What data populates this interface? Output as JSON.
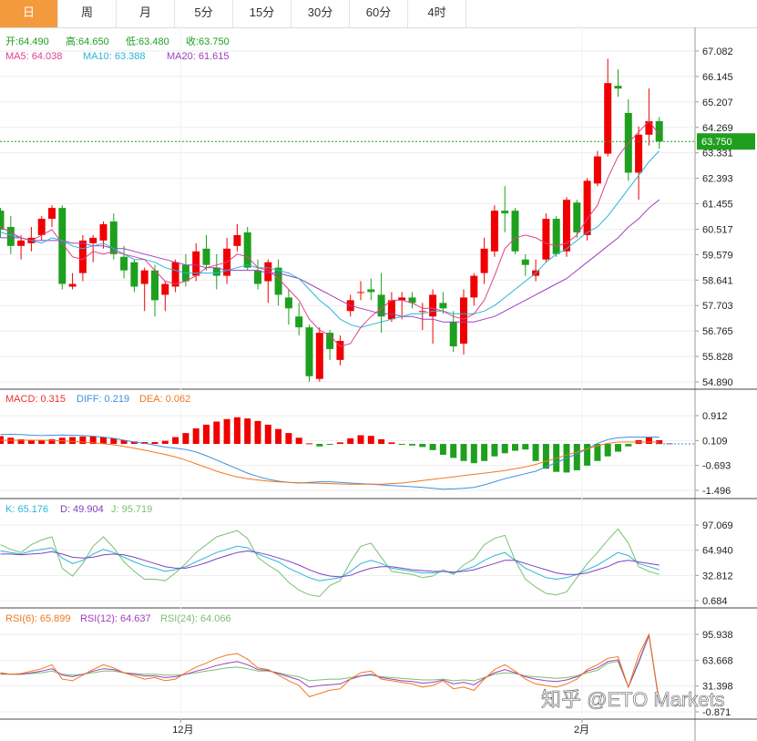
{
  "tabs": [
    "日",
    "周",
    "月",
    "5分",
    "15分",
    "30分",
    "60分",
    "4时"
  ],
  "active_tab": 0,
  "ohlc_labels": {
    "open": "开:64.490",
    "high": "高:64.650",
    "low": "低:63.480",
    "close": "收:63.750"
  },
  "ma_labels": {
    "ma5": "MA5: 64.038",
    "ma10": "MA10: 63.388",
    "ma20": "MA20: 61.615"
  },
  "macd_labels": {
    "macd": "MACD: 0.315",
    "diff": "DIFF: 0.219",
    "dea": "DEA: 0.062"
  },
  "kdj_labels": {
    "k": "K: 65.176",
    "d": "D: 49.904",
    "j": "J: 95.719"
  },
  "rsi_labels": {
    "rsi6": "RSI(6): 65.899",
    "rsi12": "RSI(12): 64.637",
    "rsi24": "RSI(24): 64.066"
  },
  "watermark": "知乎 @ETO Markets",
  "colors": {
    "up": "#f00000",
    "down": "#1ea01e",
    "ma5": "#e0408c",
    "ma10": "#29b6d8",
    "ma20": "#a040c0",
    "diff": "#3d8ee0",
    "dea": "#f07820",
    "k": "#29b6d8",
    "d": "#8040c0",
    "j": "#7ac070",
    "rsi6": "#f07820",
    "rsi12": "#a040c0",
    "rsi24": "#7ac070",
    "price_tag": "#1ea01e",
    "tab_active": "#f39a3c"
  },
  "chart_data": [
    {
      "type": "candlestick",
      "name_label": "",
      "yticks": [
        "67.082",
        "66.145",
        "65.207",
        "64.269",
        "63.331",
        "62.393",
        "61.455",
        "60.517",
        "59.579",
        "58.641",
        "57.703",
        "56.765",
        "55.828",
        "54.890"
      ],
      "ylim": [
        54.89,
        67.082
      ],
      "xticks": [
        {
          "label": "12月",
          "index": 17.5
        },
        {
          "label": "2月",
          "index": 56.5
        }
      ],
      "last_price": "63.750",
      "ohlc": [
        [
          61.2,
          61.3,
          60.2,
          60.5
        ],
        [
          60.6,
          61.0,
          59.6,
          59.9
        ],
        [
          59.9,
          60.3,
          59.4,
          60.1
        ],
        [
          60.0,
          60.6,
          59.7,
          60.2
        ],
        [
          60.3,
          61.0,
          60.1,
          60.9
        ],
        [
          60.9,
          61.4,
          60.6,
          61.3
        ],
        [
          61.3,
          61.4,
          58.3,
          58.5
        ],
        [
          58.4,
          58.9,
          58.3,
          58.5
        ],
        [
          58.9,
          60.3,
          58.6,
          60.1
        ],
        [
          60.0,
          60.3,
          59.3,
          60.2
        ],
        [
          60.1,
          60.8,
          59.8,
          60.7
        ],
        [
          60.8,
          61.1,
          59.4,
          59.6
        ],
        [
          59.5,
          59.9,
          58.7,
          59.0
        ],
        [
          59.3,
          59.4,
          58.2,
          58.4
        ],
        [
          58.5,
          59.1,
          57.5,
          59.0
        ],
        [
          59.0,
          59.2,
          57.3,
          57.9
        ],
        [
          58.1,
          58.6,
          57.5,
          58.5
        ],
        [
          58.4,
          59.4,
          58.2,
          59.3
        ],
        [
          59.2,
          59.6,
          58.4,
          58.6
        ],
        [
          58.8,
          60.0,
          58.6,
          59.7
        ],
        [
          59.8,
          60.3,
          59.0,
          59.2
        ],
        [
          59.1,
          59.6,
          58.3,
          58.8
        ],
        [
          58.8,
          60.2,
          58.5,
          59.8
        ],
        [
          59.9,
          60.7,
          59.7,
          60.3
        ],
        [
          60.4,
          60.6,
          59.0,
          59.1
        ],
        [
          59.0,
          59.4,
          58.3,
          58.5
        ],
        [
          58.6,
          59.4,
          57.8,
          59.3
        ],
        [
          59.1,
          59.4,
          57.7,
          58.1
        ],
        [
          58.0,
          58.3,
          57.0,
          57.6
        ],
        [
          57.3,
          57.8,
          56.6,
          56.9
        ],
        [
          56.9,
          57.0,
          54.9,
          55.1
        ],
        [
          55.0,
          56.9,
          54.9,
          56.7
        ],
        [
          56.7,
          56.8,
          55.7,
          56.1
        ],
        [
          55.7,
          56.6,
          55.5,
          56.4
        ],
        [
          57.5,
          58.1,
          57.3,
          57.9
        ],
        [
          58.2,
          58.6,
          57.9,
          58.2
        ],
        [
          58.3,
          58.7,
          57.9,
          58.2
        ],
        [
          58.1,
          58.9,
          56.7,
          57.3
        ],
        [
          57.2,
          58.2,
          57.1,
          57.9
        ],
        [
          57.9,
          58.2,
          57.2,
          58.0
        ],
        [
          58.0,
          58.2,
          57.6,
          57.8
        ],
        [
          57.5,
          57.8,
          56.8,
          57.5
        ],
        [
          57.3,
          58.3,
          56.3,
          58.1
        ],
        [
          57.8,
          58.2,
          57.4,
          57.6
        ],
        [
          57.1,
          57.5,
          56.0,
          56.2
        ],
        [
          56.3,
          58.3,
          55.9,
          58.0
        ],
        [
          58.0,
          58.9,
          57.7,
          58.8
        ],
        [
          58.9,
          60.2,
          58.5,
          59.8
        ],
        [
          59.7,
          61.4,
          59.5,
          61.2
        ],
        [
          61.2,
          62.1,
          60.4,
          61.1
        ],
        [
          61.2,
          61.3,
          59.6,
          59.7
        ],
        [
          59.4,
          59.6,
          58.8,
          59.2
        ],
        [
          58.8,
          59.4,
          58.6,
          59.0
        ],
        [
          59.4,
          61.1,
          59.3,
          60.9
        ],
        [
          60.9,
          61.0,
          59.5,
          59.6
        ],
        [
          59.7,
          61.7,
          59.5,
          61.6
        ],
        [
          61.5,
          61.6,
          60.2,
          60.4
        ],
        [
          60.3,
          62.4,
          60.1,
          62.3
        ],
        [
          62.2,
          63.4,
          62.1,
          63.2
        ],
        [
          63.3,
          66.8,
          63.2,
          65.9
        ],
        [
          65.8,
          66.4,
          65.4,
          65.7
        ],
        [
          64.8,
          65.3,
          62.3,
          62.6
        ],
        [
          62.6,
          64.3,
          61.6,
          64.0
        ],
        [
          64.0,
          65.7,
          63.6,
          64.5
        ],
        [
          64.5,
          64.65,
          63.48,
          63.75
        ]
      ],
      "ma5": [
        60.6,
        60.4,
        60.2,
        60.1,
        60.3,
        60.5,
        60.0,
        59.5,
        59.4,
        59.7,
        59.6,
        59.7,
        59.6,
        59.5,
        59.4,
        59.0,
        58.6,
        58.5,
        58.6,
        58.8,
        59.1,
        59.2,
        59.3,
        59.6,
        59.5,
        59.1,
        59.0,
        58.7,
        58.3,
        57.9,
        57.2,
        56.8,
        56.6,
        56.2,
        56.3,
        56.9,
        57.3,
        57.6,
        57.9,
        57.9,
        57.8,
        57.6,
        57.6,
        57.5,
        57.3,
        57.2,
        57.4,
        57.9,
        58.8,
        59.8,
        60.2,
        60.3,
        60.2,
        60.0,
        59.9,
        60.0,
        60.3,
        60.9,
        61.4,
        62.4,
        63.2,
        63.7,
        64.1,
        64.5,
        64.0
      ],
      "ma10": [
        60.4,
        60.3,
        60.2,
        60.1,
        60.0,
        60.2,
        60.1,
        59.9,
        59.8,
        59.9,
        60.0,
        59.8,
        59.6,
        59.4,
        59.4,
        59.3,
        59.1,
        59.0,
        58.9,
        58.9,
        58.9,
        58.9,
        59.0,
        59.1,
        59.2,
        59.1,
        59.1,
        59.0,
        58.9,
        58.7,
        58.3,
        57.9,
        57.6,
        57.2,
        57.0,
        56.9,
        57.0,
        57.1,
        57.2,
        57.3,
        57.4,
        57.4,
        57.5,
        57.5,
        57.4,
        57.4,
        57.4,
        57.5,
        57.7,
        58.0,
        58.3,
        58.6,
        58.9,
        59.3,
        59.6,
        59.8,
        60.1,
        60.4,
        60.6,
        61.0,
        61.5,
        62.0,
        62.5,
        63.0,
        63.4
      ],
      "ma20": [
        60.2,
        60.2,
        60.2,
        60.1,
        60.1,
        60.1,
        60.1,
        60.0,
        60.0,
        59.9,
        59.9,
        59.8,
        59.8,
        59.7,
        59.6,
        59.5,
        59.4,
        59.3,
        59.2,
        59.2,
        59.1,
        59.1,
        59.0,
        59.0,
        59.0,
        59.0,
        58.9,
        58.9,
        58.8,
        58.7,
        58.5,
        58.3,
        58.1,
        57.9,
        57.7,
        57.6,
        57.5,
        57.4,
        57.4,
        57.3,
        57.3,
        57.2,
        57.2,
        57.1,
        57.1,
        57.1,
        57.1,
        57.2,
        57.3,
        57.5,
        57.7,
        57.9,
        58.1,
        58.3,
        58.5,
        58.7,
        59.0,
        59.3,
        59.6,
        59.9,
        60.2,
        60.6,
        60.9,
        61.3,
        61.6
      ]
    },
    {
      "type": "macd",
      "yticks": [
        "0.912",
        "0.109",
        "-0.693",
        "-1.496"
      ],
      "ylim": [
        -1.496,
        0.912
      ],
      "hist": [
        0.25,
        0.2,
        0.15,
        0.12,
        0.12,
        0.15,
        0.2,
        0.22,
        0.24,
        0.24,
        0.22,
        0.18,
        0.12,
        0.08,
        0.06,
        0.06,
        0.1,
        0.22,
        0.35,
        0.5,
        0.62,
        0.72,
        0.8,
        0.86,
        0.82,
        0.74,
        0.62,
        0.48,
        0.35,
        0.2,
        0.02,
        -0.08,
        -0.02,
        0.05,
        0.18,
        0.28,
        0.26,
        0.15,
        0.05,
        -0.02,
        -0.05,
        -0.1,
        -0.2,
        -0.35,
        -0.45,
        -0.55,
        -0.62,
        -0.55,
        -0.4,
        -0.3,
        -0.22,
        -0.18,
        -0.55,
        -0.8,
        -0.9,
        -0.92,
        -0.85,
        -0.7,
        -0.55,
        -0.4,
        -0.25,
        -0.08,
        0.12,
        0.22,
        0.12,
        0.02
      ],
      "diff": [
        0.3,
        0.31,
        0.3,
        0.28,
        0.27,
        0.28,
        0.29,
        0.28,
        0.27,
        0.25,
        0.22,
        0.18,
        0.12,
        0.06,
        0.02,
        -0.04,
        -0.1,
        -0.14,
        -0.18,
        -0.26,
        -0.38,
        -0.52,
        -0.66,
        -0.8,
        -0.94,
        -1.05,
        -1.14,
        -1.2,
        -1.24,
        -1.26,
        -1.24,
        -1.22,
        -1.22,
        -1.24,
        -1.26,
        -1.28,
        -1.3,
        -1.32,
        -1.34,
        -1.36,
        -1.38,
        -1.4,
        -1.43,
        -1.46,
        -1.45,
        -1.43,
        -1.4,
        -1.32,
        -1.22,
        -1.12,
        -1.04,
        -0.96,
        -0.88,
        -0.74,
        -0.6,
        -0.46,
        -0.32,
        -0.16,
        0.02,
        0.14,
        0.2,
        0.22,
        0.22,
        0.22,
        0.22
      ],
      "dea": [
        0.12,
        0.12,
        0.12,
        0.12,
        0.12,
        0.11,
        0.1,
        0.08,
        0.06,
        0.04,
        0.01,
        -0.03,
        -0.08,
        -0.14,
        -0.2,
        -0.27,
        -0.34,
        -0.42,
        -0.52,
        -0.64,
        -0.76,
        -0.88,
        -0.98,
        -1.06,
        -1.12,
        -1.16,
        -1.2,
        -1.22,
        -1.24,
        -1.25,
        -1.26,
        -1.27,
        -1.28,
        -1.29,
        -1.3,
        -1.3,
        -1.3,
        -1.3,
        -1.28,
        -1.26,
        -1.22,
        -1.18,
        -1.14,
        -1.1,
        -1.06,
        -1.02,
        -0.98,
        -0.94,
        -0.9,
        -0.86,
        -0.8,
        -0.74,
        -0.66,
        -0.56,
        -0.46,
        -0.36,
        -0.26,
        -0.16,
        -0.06,
        0.02,
        0.06,
        0.06,
        0.06,
        0.06,
        0.06
      ]
    },
    {
      "type": "kdj",
      "yticks": [
        "97.069",
        "64.940",
        "32.812",
        "0.684"
      ],
      "ylim": [
        0.684,
        97.069
      ],
      "k": [
        64,
        62,
        60,
        64,
        66,
        68,
        55,
        48,
        52,
        60,
        66,
        62,
        56,
        50,
        45,
        42,
        38,
        40,
        44,
        50,
        56,
        62,
        66,
        70,
        68,
        60,
        55,
        50,
        42,
        36,
        30,
        26,
        28,
        30,
        38,
        48,
        52,
        48,
        42,
        40,
        38,
        36,
        36,
        38,
        36,
        40,
        44,
        52,
        58,
        62,
        52,
        42,
        36,
        30,
        28,
        30,
        34,
        40,
        46,
        54,
        62,
        58,
        48,
        44,
        40
      ],
      "d": [
        60,
        60,
        59,
        60,
        61,
        63,
        60,
        56,
        55,
        56,
        59,
        60,
        59,
        56,
        52,
        48,
        44,
        42,
        42,
        45,
        49,
        54,
        58,
        62,
        64,
        62,
        59,
        55,
        51,
        46,
        40,
        35,
        32,
        31,
        33,
        38,
        42,
        44,
        44,
        42,
        40,
        39,
        38,
        38,
        37,
        38,
        40,
        44,
        48,
        52,
        52,
        48,
        44,
        40,
        36,
        34,
        34,
        36,
        40,
        44,
        50,
        52,
        50,
        48,
        46
      ],
      "j": [
        72,
        66,
        62,
        72,
        78,
        82,
        42,
        32,
        48,
        70,
        82,
        68,
        50,
        38,
        28,
        28,
        26,
        36,
        48,
        62,
        72,
        82,
        86,
        90,
        80,
        56,
        46,
        38,
        24,
        14,
        8,
        6,
        20,
        26,
        50,
        70,
        74,
        56,
        38,
        36,
        34,
        30,
        32,
        40,
        34,
        46,
        54,
        72,
        80,
        84,
        52,
        28,
        18,
        10,
        8,
        12,
        30,
        48,
        62,
        78,
        92,
        74,
        44,
        38,
        34
      ]
    },
    {
      "type": "rsi",
      "yticks": [
        "95.938",
        "63.668",
        "31.398",
        "-0.871"
      ],
      "ylim": [
        -0.871,
        95.938
      ],
      "rsi6": [
        48,
        46,
        47,
        50,
        53,
        58,
        40,
        38,
        45,
        52,
        58,
        54,
        48,
        44,
        40,
        42,
        38,
        40,
        48,
        55,
        60,
        66,
        70,
        72,
        65,
        54,
        52,
        45,
        38,
        32,
        18,
        22,
        26,
        28,
        40,
        48,
        50,
        40,
        38,
        36,
        34,
        30,
        32,
        38,
        28,
        30,
        26,
        40,
        52,
        58,
        50,
        40,
        34,
        32,
        30,
        34,
        40,
        52,
        58,
        66,
        68,
        30,
        70,
        96,
        12
      ],
      "rsi12": [
        47,
        46,
        46,
        48,
        50,
        53,
        45,
        43,
        46,
        50,
        53,
        52,
        48,
        46,
        44,
        44,
        42,
        43,
        46,
        50,
        53,
        57,
        60,
        62,
        58,
        52,
        51,
        47,
        43,
        39,
        30,
        32,
        33,
        34,
        40,
        44,
        46,
        42,
        40,
        38,
        37,
        35,
        36,
        39,
        34,
        36,
        33,
        41,
        48,
        52,
        48,
        43,
        40,
        38,
        37,
        39,
        43,
        50,
        54,
        62,
        64,
        30,
        62,
        95,
        10
      ],
      "rsi24": [
        46,
        46,
        46,
        47,
        48,
        50,
        46,
        45,
        46,
        48,
        50,
        50,
        48,
        47,
        46,
        46,
        45,
        45,
        46,
        48,
        50,
        52,
        54,
        55,
        53,
        50,
        50,
        48,
        45,
        43,
        38,
        39,
        40,
        40,
        42,
        44,
        45,
        43,
        42,
        41,
        40,
        39,
        39,
        40,
        38,
        39,
        38,
        42,
        46,
        48,
        47,
        44,
        43,
        42,
        41,
        42,
        44,
        48,
        51,
        60,
        62,
        30,
        60,
        94,
        10
      ]
    }
  ]
}
